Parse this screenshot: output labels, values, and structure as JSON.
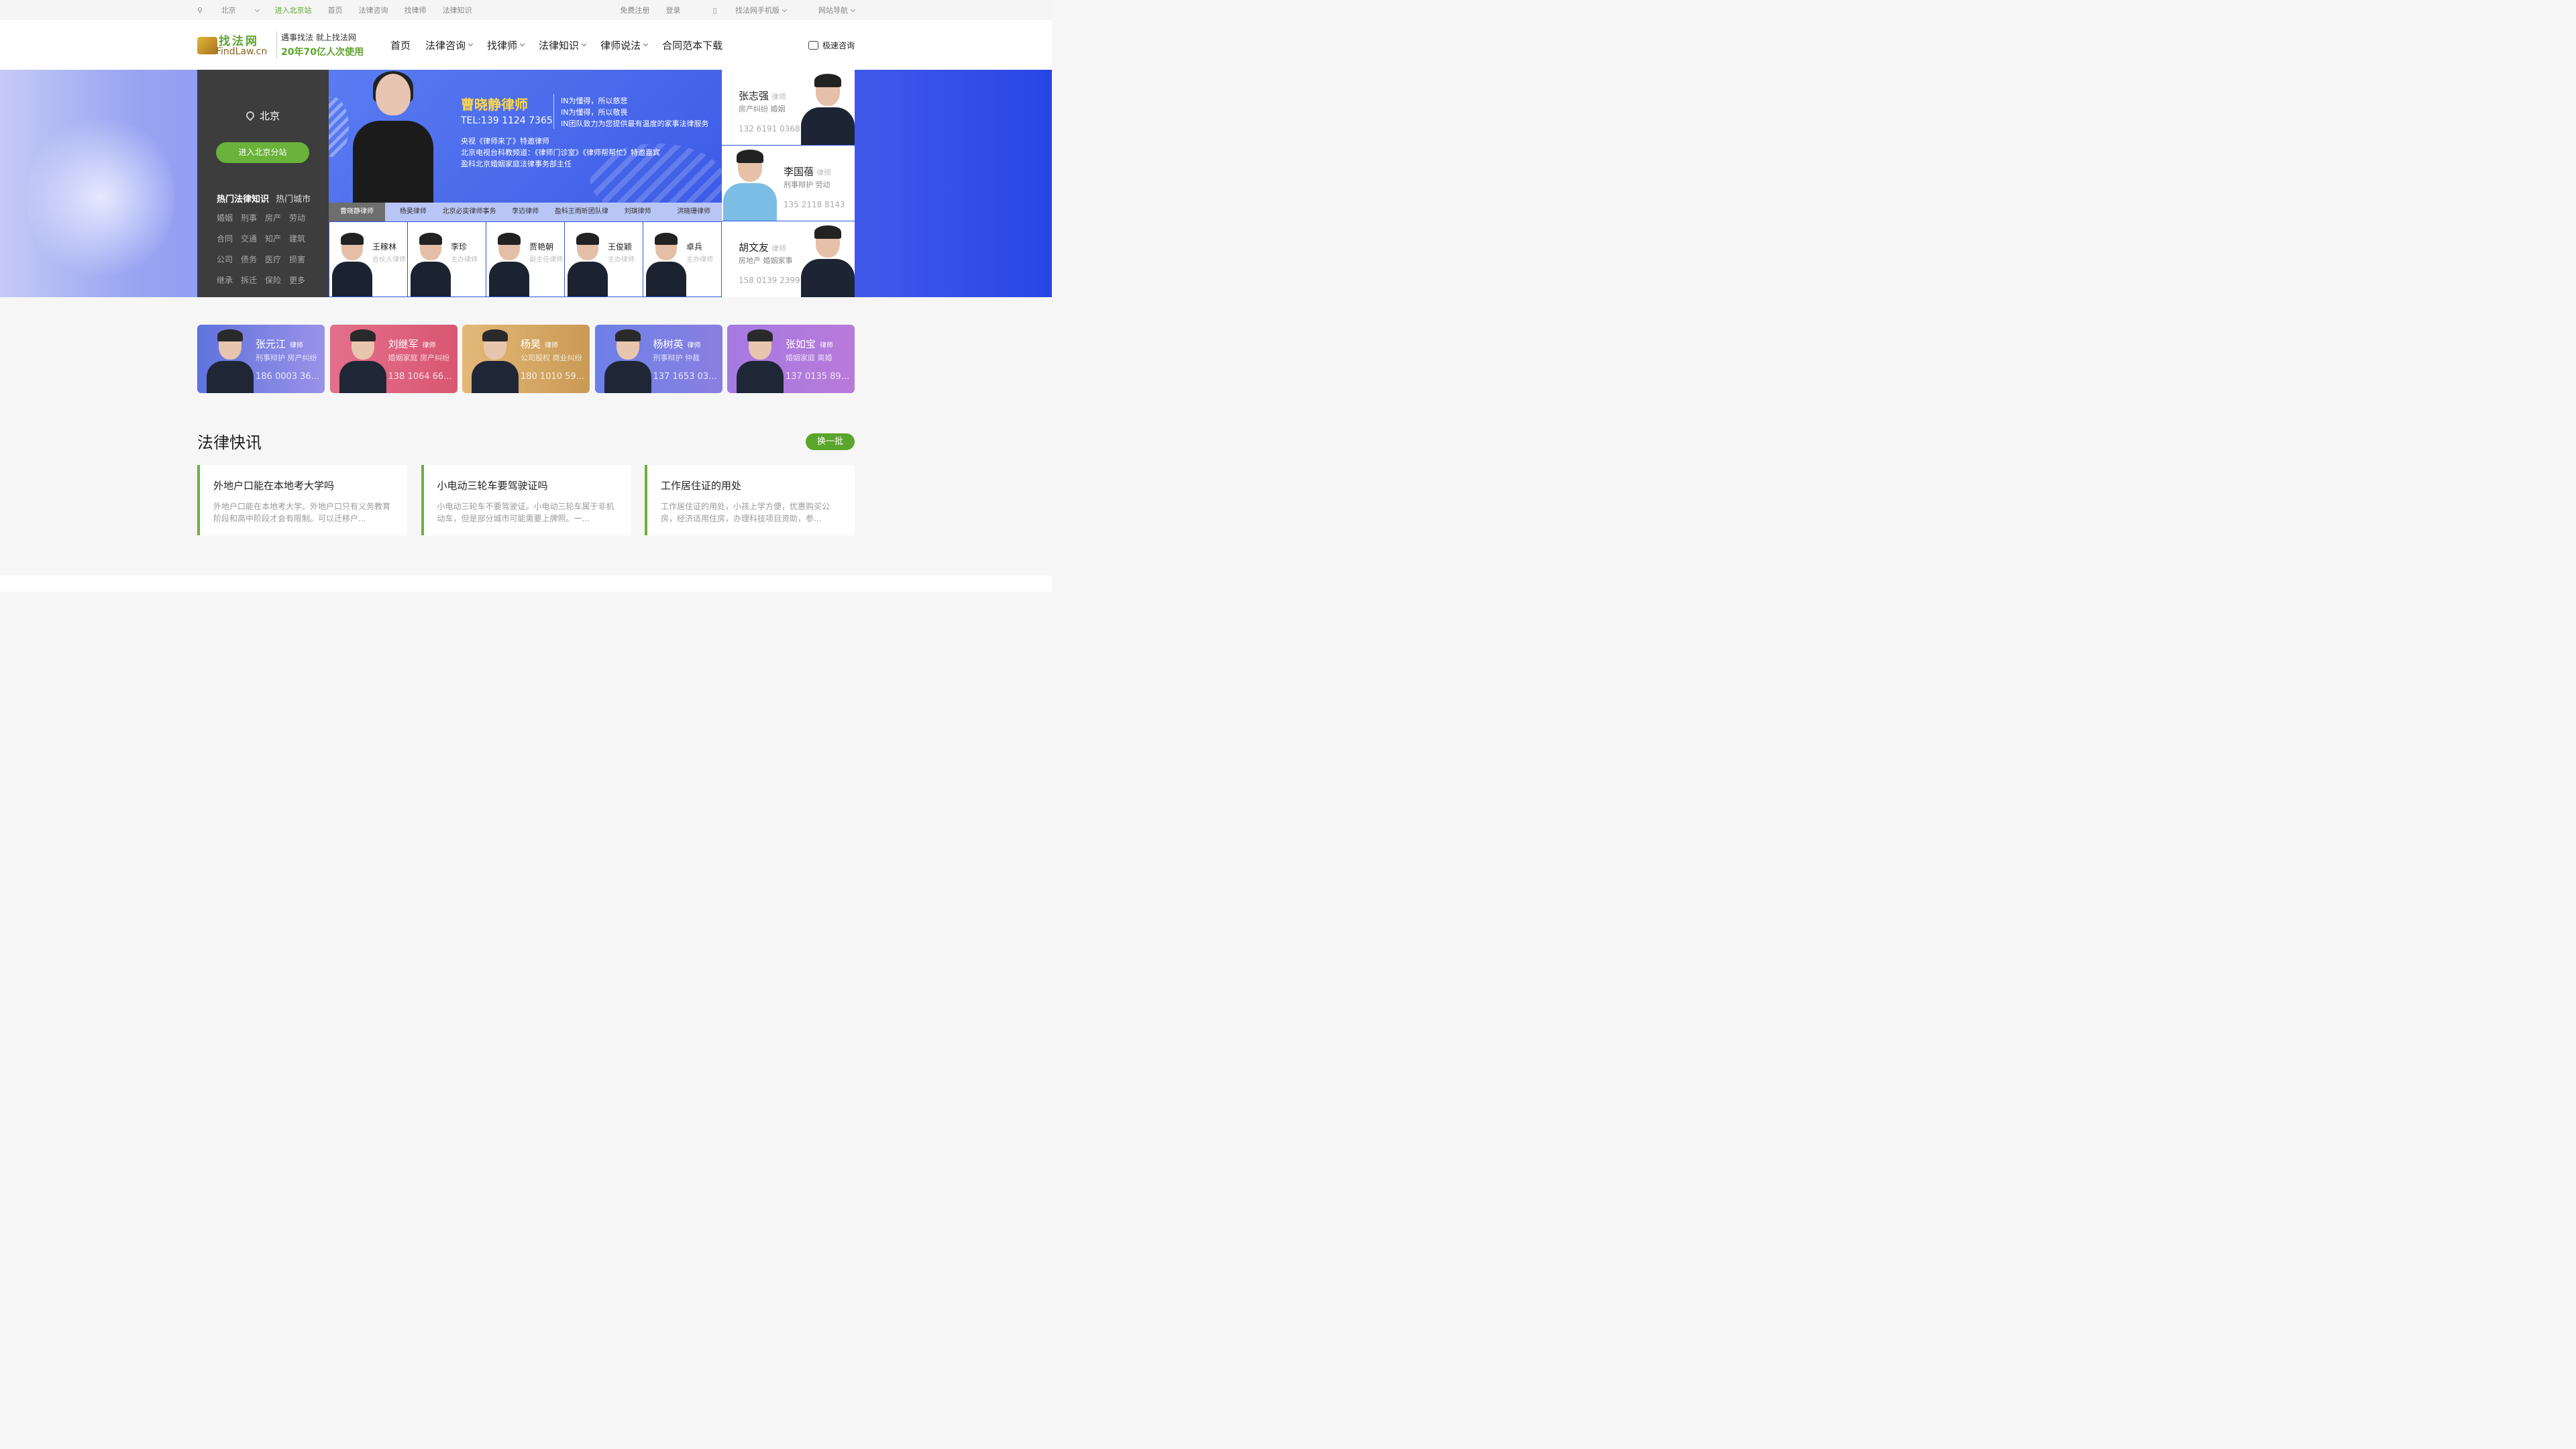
{
  "topbar": {
    "location": "北京",
    "enter_site": "进入北京站",
    "links": [
      "首页",
      "法律咨询",
      "找律师",
      "法律知识"
    ],
    "register": "免费注册",
    "login": "登录",
    "mobile": "找法网手机版",
    "sitemap": "网站导航"
  },
  "header": {
    "logo_cn": "找法网",
    "logo_en": "FindLaw.cn",
    "slogan_1": "遇事找法 就上找法网",
    "slogan_2": "20年70亿人次使用",
    "nav": [
      "首页",
      "法律咨询",
      "找律师",
      "法律知识",
      "律师说法",
      "合同范本下载"
    ],
    "quick_consult": "极速咨询"
  },
  "side": {
    "city": "北京",
    "button": "进入北京分站",
    "tab_active": "热门法律知识",
    "tab_inactive": "热门城市",
    "topics": [
      "婚姻",
      "刑事",
      "房产",
      "劳动",
      "合同",
      "交通",
      "知产",
      "建筑",
      "公司",
      "债务",
      "医疗",
      "损害",
      "继承",
      "拆迁",
      "保险",
      "更多"
    ]
  },
  "ad": {
    "title": "曹晓静律师",
    "tel": "TEL:139 1124 7365",
    "in_lines": [
      "IN为懂得，所以慈悲",
      "IN为懂得，所以敬畏",
      "IN团队致力为您提供最有温度的家事法律服务"
    ],
    "desc_lines": [
      "央视《律师来了》特邀律师",
      "北京电视台科教频道：《律师门诊室》《律师帮帮忙》特邀嘉宾",
      "盈科北京婚姻家庭法律事务部主任"
    ],
    "tabs": [
      "曹晓静律师",
      "杨昊律师",
      "北京必奕律师事务",
      "李迈律师",
      "盈科王雨昕团队律",
      "刘琪律师",
      "洪晓珊律师"
    ]
  },
  "lawyer_row": [
    {
      "name": "王稼林",
      "title": "合伙人律师"
    },
    {
      "name": "李珍",
      "title": "主办律师"
    },
    {
      "name": "贾艳朝",
      "title": "副主任律师"
    },
    {
      "name": "王俊颖",
      "title": "主办律师"
    },
    {
      "name": "卓兵",
      "title": "主办律师"
    }
  ],
  "right_lawyers": [
    {
      "name": "张志强",
      "role": "律师",
      "fields": "房产纠纷 婚姻",
      "phone": "132 6191 0368"
    },
    {
      "name": "李国蓓",
      "role": "律师",
      "fields": "刑事辩护 劳动",
      "phone": "135 2118 8143"
    },
    {
      "name": "胡文友",
      "role": "律师",
      "fields": "房地产 婚姻家事",
      "phone": "158 0139 2399"
    }
  ],
  "featured": [
    {
      "name": "张元江",
      "role": "律师",
      "fields": "刑事辩护 房产纠纷",
      "phone": "186 0003 36...",
      "color1": "#5f73dd",
      "color2": "#9a92e8"
    },
    {
      "name": "刘继军",
      "role": "律师",
      "fields": "婚姻家庭 房产纠纷",
      "phone": "138 1064 66...",
      "color1": "#e3708c",
      "color2": "#d95672"
    },
    {
      "name": "杨昊",
      "role": "律师",
      "fields": "公司股权 商业纠纷",
      "phone": "180 1010 59...",
      "color1": "#e4b878",
      "color2": "#c99a55"
    },
    {
      "name": "杨树英",
      "role": "律师",
      "fields": "刑事辩护 仲裁",
      "phone": "137 1653 03...",
      "color1": "#6d80e8",
      "color2": "#8a7fe0"
    },
    {
      "name": "张如宝",
      "role": "律师",
      "fields": "婚姻家庭 离婚",
      "phone": "137 0135 89...",
      "color1": "#a57ae3",
      "color2": "#b87ad9"
    }
  ],
  "news": {
    "title": "法律快讯",
    "refresh": "换一批",
    "items": [
      {
        "title": "外地户口能在本地考大学吗",
        "summary": "外地户口能在本地考大学。外地户口只有义务教育阶段和高中阶段才会有限制。可以迁移户..."
      },
      {
        "title": "小电动三轮车要驾驶证吗",
        "summary": "小电动三轮车不要驾驶证。小电动三轮车属于非机动车，但是部分城市可能需要上牌照。一..."
      },
      {
        "title": "工作居住证的用处",
        "summary": "工作居住证的用处，小孩上学方便，优惠购买公房，经济适用住房，办理科技项目资助，参..."
      }
    ]
  }
}
